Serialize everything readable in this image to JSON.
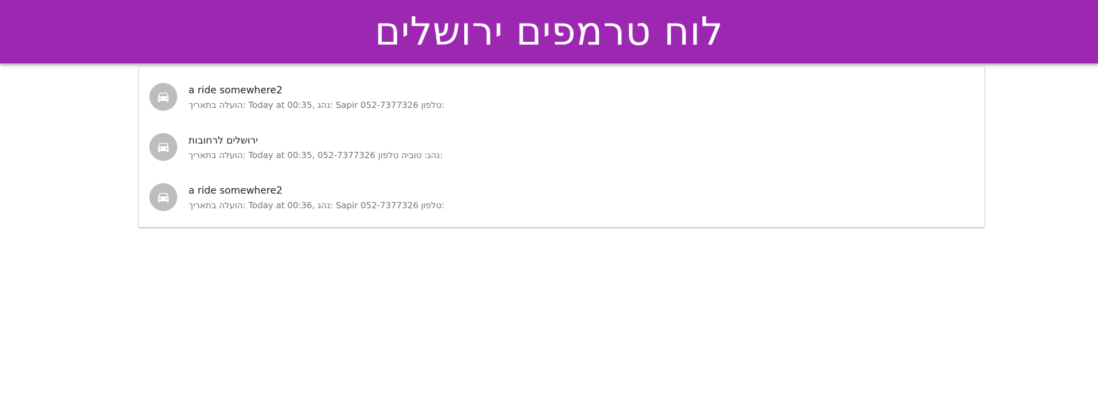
{
  "header": {
    "title": "לוח טרמפים ירושלים",
    "background_color": "#9c27b0"
  },
  "rides": [
    {
      "icon": "car-icon",
      "title": "a ride somewhere2",
      "meta": "הועלה בתאריך: Today at 00:35, נהג: Sapir 052-7377326 טלפון:"
    },
    {
      "icon": "car-icon",
      "title": "ירושלים לרחובות",
      "meta": "הועלה בתאריך: Today at 00:35, 052-7377326 נהג: טוביה טלפון:"
    },
    {
      "icon": "car-icon",
      "title": "a ride somewhere2",
      "meta": "הועלה בתאריך: Today at 00:36, נהג: Sapir 052-7377326 טלפון:"
    }
  ]
}
